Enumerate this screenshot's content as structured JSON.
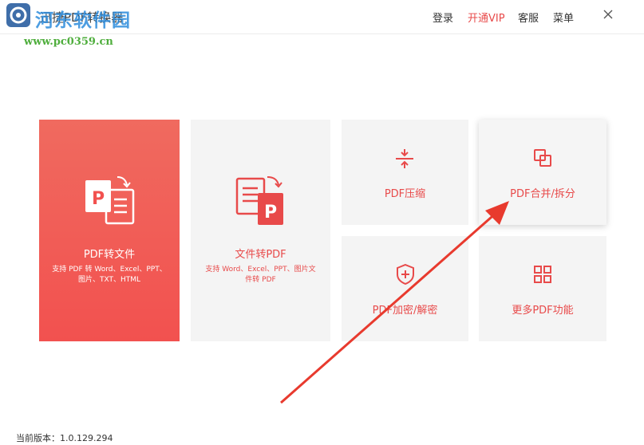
{
  "window": {
    "title": "迅捷PDF转换器",
    "watermark": "河东软件园",
    "watermark_url": "www.pc0359.cn"
  },
  "header": {
    "login_label": "登录",
    "vip_label": "开通VIP",
    "service_label": "客服",
    "menu_label": "菜单",
    "close_icon": "close-icon"
  },
  "tiles": {
    "pdf_to_file": {
      "label": "PDF转文件",
      "description": "支持 PDF 转 Word、Excel、PPT、图片、TXT、HTML",
      "icon": "pdf-to-document-icon"
    },
    "file_to_pdf": {
      "label": "文件转PDF",
      "description": "支持 Word、Excel、PPT、图片文件转 PDF",
      "icon": "document-to-pdf-icon"
    },
    "compress": {
      "label": "PDF压缩",
      "icon": "compress-icon"
    },
    "merge_split": {
      "label": "PDF合并/拆分",
      "icon": "merge-icon"
    },
    "encrypt": {
      "label": "PDF加密/解密",
      "icon": "shield-icon"
    },
    "more": {
      "label": "更多PDF功能",
      "icon": "grid-icon"
    }
  },
  "footer": {
    "version": "当前版本：1.0.129.294"
  },
  "colors": {
    "accent": "#f2514f",
    "tile_bg": "#f4f4f4",
    "annotation_arrow": "#e83a2e"
  }
}
